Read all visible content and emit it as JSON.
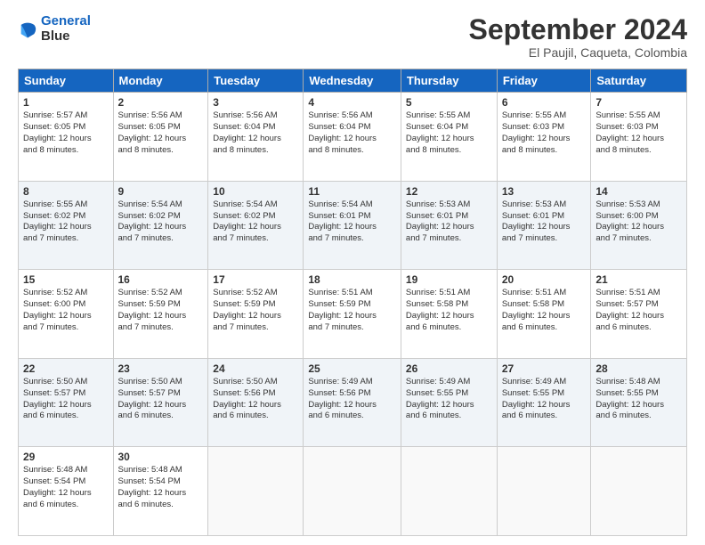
{
  "header": {
    "logo_line1": "General",
    "logo_line2": "Blue",
    "month": "September 2024",
    "location": "El Paujil, Caqueta, Colombia"
  },
  "days_header": [
    "Sunday",
    "Monday",
    "Tuesday",
    "Wednesday",
    "Thursday",
    "Friday",
    "Saturday"
  ],
  "weeks": [
    [
      {
        "day": "1",
        "lines": [
          "Sunrise: 5:57 AM",
          "Sunset: 6:05 PM",
          "Daylight: 12 hours",
          "and 8 minutes."
        ]
      },
      {
        "day": "2",
        "lines": [
          "Sunrise: 5:56 AM",
          "Sunset: 6:05 PM",
          "Daylight: 12 hours",
          "and 8 minutes."
        ]
      },
      {
        "day": "3",
        "lines": [
          "Sunrise: 5:56 AM",
          "Sunset: 6:04 PM",
          "Daylight: 12 hours",
          "and 8 minutes."
        ]
      },
      {
        "day": "4",
        "lines": [
          "Sunrise: 5:56 AM",
          "Sunset: 6:04 PM",
          "Daylight: 12 hours",
          "and 8 minutes."
        ]
      },
      {
        "day": "5",
        "lines": [
          "Sunrise: 5:55 AM",
          "Sunset: 6:04 PM",
          "Daylight: 12 hours",
          "and 8 minutes."
        ]
      },
      {
        "day": "6",
        "lines": [
          "Sunrise: 5:55 AM",
          "Sunset: 6:03 PM",
          "Daylight: 12 hours",
          "and 8 minutes."
        ]
      },
      {
        "day": "7",
        "lines": [
          "Sunrise: 5:55 AM",
          "Sunset: 6:03 PM",
          "Daylight: 12 hours",
          "and 8 minutes."
        ]
      }
    ],
    [
      {
        "day": "8",
        "lines": [
          "Sunrise: 5:55 AM",
          "Sunset: 6:02 PM",
          "Daylight: 12 hours",
          "and 7 minutes."
        ]
      },
      {
        "day": "9",
        "lines": [
          "Sunrise: 5:54 AM",
          "Sunset: 6:02 PM",
          "Daylight: 12 hours",
          "and 7 minutes."
        ]
      },
      {
        "day": "10",
        "lines": [
          "Sunrise: 5:54 AM",
          "Sunset: 6:02 PM",
          "Daylight: 12 hours",
          "and 7 minutes."
        ]
      },
      {
        "day": "11",
        "lines": [
          "Sunrise: 5:54 AM",
          "Sunset: 6:01 PM",
          "Daylight: 12 hours",
          "and 7 minutes."
        ]
      },
      {
        "day": "12",
        "lines": [
          "Sunrise: 5:53 AM",
          "Sunset: 6:01 PM",
          "Daylight: 12 hours",
          "and 7 minutes."
        ]
      },
      {
        "day": "13",
        "lines": [
          "Sunrise: 5:53 AM",
          "Sunset: 6:01 PM",
          "Daylight: 12 hours",
          "and 7 minutes."
        ]
      },
      {
        "day": "14",
        "lines": [
          "Sunrise: 5:53 AM",
          "Sunset: 6:00 PM",
          "Daylight: 12 hours",
          "and 7 minutes."
        ]
      }
    ],
    [
      {
        "day": "15",
        "lines": [
          "Sunrise: 5:52 AM",
          "Sunset: 6:00 PM",
          "Daylight: 12 hours",
          "and 7 minutes."
        ]
      },
      {
        "day": "16",
        "lines": [
          "Sunrise: 5:52 AM",
          "Sunset: 5:59 PM",
          "Daylight: 12 hours",
          "and 7 minutes."
        ]
      },
      {
        "day": "17",
        "lines": [
          "Sunrise: 5:52 AM",
          "Sunset: 5:59 PM",
          "Daylight: 12 hours",
          "and 7 minutes."
        ]
      },
      {
        "day": "18",
        "lines": [
          "Sunrise: 5:51 AM",
          "Sunset: 5:59 PM",
          "Daylight: 12 hours",
          "and 7 minutes."
        ]
      },
      {
        "day": "19",
        "lines": [
          "Sunrise: 5:51 AM",
          "Sunset: 5:58 PM",
          "Daylight: 12 hours",
          "and 6 minutes."
        ]
      },
      {
        "day": "20",
        "lines": [
          "Sunrise: 5:51 AM",
          "Sunset: 5:58 PM",
          "Daylight: 12 hours",
          "and 6 minutes."
        ]
      },
      {
        "day": "21",
        "lines": [
          "Sunrise: 5:51 AM",
          "Sunset: 5:57 PM",
          "Daylight: 12 hours",
          "and 6 minutes."
        ]
      }
    ],
    [
      {
        "day": "22",
        "lines": [
          "Sunrise: 5:50 AM",
          "Sunset: 5:57 PM",
          "Daylight: 12 hours",
          "and 6 minutes."
        ]
      },
      {
        "day": "23",
        "lines": [
          "Sunrise: 5:50 AM",
          "Sunset: 5:57 PM",
          "Daylight: 12 hours",
          "and 6 minutes."
        ]
      },
      {
        "day": "24",
        "lines": [
          "Sunrise: 5:50 AM",
          "Sunset: 5:56 PM",
          "Daylight: 12 hours",
          "and 6 minutes."
        ]
      },
      {
        "day": "25",
        "lines": [
          "Sunrise: 5:49 AM",
          "Sunset: 5:56 PM",
          "Daylight: 12 hours",
          "and 6 minutes."
        ]
      },
      {
        "day": "26",
        "lines": [
          "Sunrise: 5:49 AM",
          "Sunset: 5:55 PM",
          "Daylight: 12 hours",
          "and 6 minutes."
        ]
      },
      {
        "day": "27",
        "lines": [
          "Sunrise: 5:49 AM",
          "Sunset: 5:55 PM",
          "Daylight: 12 hours",
          "and 6 minutes."
        ]
      },
      {
        "day": "28",
        "lines": [
          "Sunrise: 5:48 AM",
          "Sunset: 5:55 PM",
          "Daylight: 12 hours",
          "and 6 minutes."
        ]
      }
    ],
    [
      {
        "day": "29",
        "lines": [
          "Sunrise: 5:48 AM",
          "Sunset: 5:54 PM",
          "Daylight: 12 hours",
          "and 6 minutes."
        ]
      },
      {
        "day": "30",
        "lines": [
          "Sunrise: 5:48 AM",
          "Sunset: 5:54 PM",
          "Daylight: 12 hours",
          "and 6 minutes."
        ]
      },
      {
        "day": "",
        "lines": []
      },
      {
        "day": "",
        "lines": []
      },
      {
        "day": "",
        "lines": []
      },
      {
        "day": "",
        "lines": []
      },
      {
        "day": "",
        "lines": []
      }
    ]
  ]
}
